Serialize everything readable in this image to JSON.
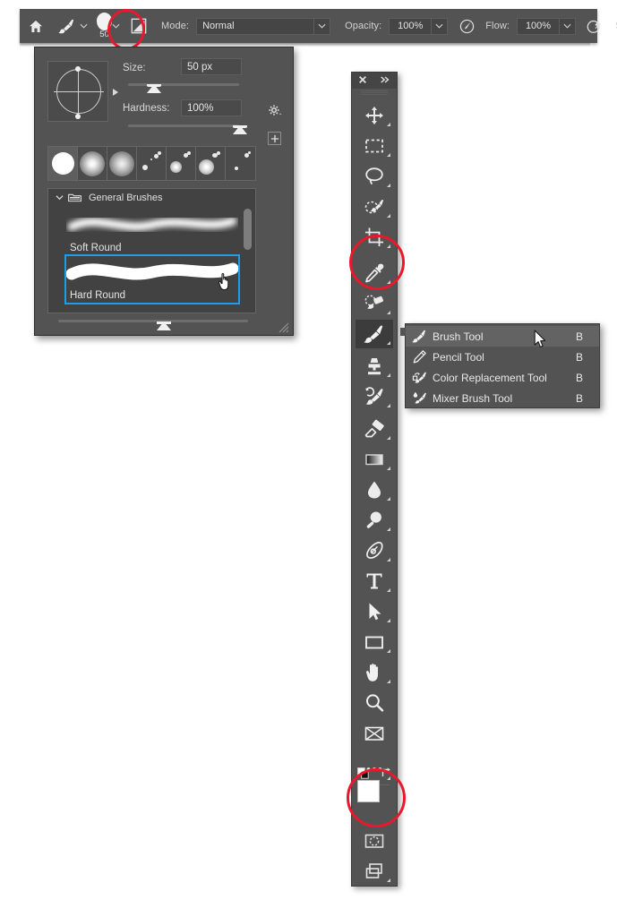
{
  "options_bar": {
    "home_icon": "home-icon",
    "brush_tool_icon": "brush-icon",
    "brush_size_value": "50",
    "preset_picker_icon": "brush-preset-icon",
    "mode_label": "Mode:",
    "mode_value": "Normal",
    "opacity_label": "Opacity:",
    "opacity_value": "100%",
    "opacity_pressure_icon": "pressure-opacity-icon",
    "flow_label": "Flow:",
    "flow_value": "100%",
    "airbrush_icon": "airbrush-icon",
    "smoothing_label": "S"
  },
  "brush_panel": {
    "angle_control_name": "brush-angle-roundness",
    "size_label": "Size:",
    "size_value": "50 px",
    "hardness_label": "Hardness:",
    "hardness_value": "100%",
    "gear_icon": "gear-icon",
    "new_preset_icon": "new-preset-icon",
    "tips": [
      {
        "name": "hard-round-tip",
        "kind": "hard",
        "selected": true
      },
      {
        "name": "soft-round-tip",
        "kind": "soft",
        "selected": false
      },
      {
        "name": "soft-round-pressure-tip",
        "kind": "soft2",
        "selected": false
      },
      {
        "name": "spatter-tip-1",
        "kind": "spatter",
        "selected": false
      },
      {
        "name": "spatter-tip-2",
        "kind": "spatter2",
        "selected": false
      },
      {
        "name": "spatter-tip-3",
        "kind": "spatter3",
        "selected": false
      },
      {
        "name": "spatter-tip-4",
        "kind": "spatter4",
        "selected": false
      }
    ],
    "group_name": "General Brushes",
    "group_expanded": true,
    "brushes": [
      {
        "name": "Soft Round",
        "selected": false,
        "kind": "soft"
      },
      {
        "name": "Hard Round",
        "selected": true,
        "kind": "hard"
      }
    ],
    "scroll_thumb": "list-scrollbar"
  },
  "toolbar": {
    "collapse_icon": "close-icon",
    "expand_icon": "double-chevron-right-icon",
    "tools": [
      {
        "name": "move-tool",
        "icon": "move-icon",
        "has_submenu": true,
        "active": false
      },
      {
        "name": "rectangular-marquee-tool",
        "icon": "marquee-icon",
        "has_submenu": true,
        "active": false
      },
      {
        "name": "lasso-tool",
        "icon": "lasso-icon",
        "has_submenu": true,
        "active": false
      },
      {
        "name": "object-selection-tool",
        "icon": "object-selection-icon",
        "has_submenu": true,
        "active": false
      },
      {
        "name": "crop-tool",
        "icon": "crop-icon",
        "has_submenu": true,
        "active": false
      },
      {
        "name": "eyedropper-tool",
        "icon": "eyedropper-icon",
        "has_submenu": true,
        "active": false
      },
      {
        "name": "spot-healing-brush-tool",
        "icon": "healing-brush-icon",
        "has_submenu": true,
        "active": false
      },
      {
        "name": "brush-tool",
        "icon": "brush-icon",
        "has_submenu": true,
        "active": true
      },
      {
        "name": "clone-stamp-tool",
        "icon": "clone-stamp-icon",
        "has_submenu": true,
        "active": false
      },
      {
        "name": "history-brush-tool",
        "icon": "history-brush-icon",
        "has_submenu": true,
        "active": false
      },
      {
        "name": "eraser-tool",
        "icon": "eraser-icon",
        "has_submenu": true,
        "active": false
      },
      {
        "name": "gradient-tool",
        "icon": "gradient-icon",
        "has_submenu": true,
        "active": false
      },
      {
        "name": "blur-tool",
        "icon": "blur-drop-icon",
        "has_submenu": true,
        "active": false
      },
      {
        "name": "dodge-tool",
        "icon": "dodge-icon",
        "has_submenu": true,
        "active": false
      },
      {
        "name": "pen-tool",
        "icon": "pen-icon",
        "has_submenu": true,
        "active": false
      },
      {
        "name": "type-tool",
        "icon": "type-t-icon",
        "has_submenu": true,
        "active": false
      },
      {
        "name": "path-selection-tool",
        "icon": "path-arrow-icon",
        "has_submenu": true,
        "active": false
      },
      {
        "name": "rectangle-tool",
        "icon": "rectangle-icon",
        "has_submenu": true,
        "active": false
      },
      {
        "name": "hand-tool",
        "icon": "hand-icon",
        "has_submenu": true,
        "active": false
      },
      {
        "name": "zoom-tool",
        "icon": "magnifier-icon",
        "has_submenu": false,
        "active": false
      },
      {
        "name": "frame-tool",
        "icon": "frame-icon",
        "has_submenu": false,
        "active": false
      },
      {
        "name": "edit-toolbar-button",
        "icon": "ellipsis-icon",
        "has_submenu": true,
        "active": false
      }
    ],
    "foreground_color": "#ffffff",
    "background_color": "#000000",
    "default-colors-icon": "default-colors-icon",
    "swap-colors-icon": "swap-colors-icon",
    "quick_mask_icon": "quick-mask-icon",
    "screen_mode_icon": "screen-mode-icon"
  },
  "flyout_menu": {
    "items": [
      {
        "label": "Brush Tool",
        "shortcut": "B",
        "icon": "brush-icon",
        "hover": true
      },
      {
        "label": "Pencil Tool",
        "shortcut": "B",
        "icon": "pencil-icon",
        "hover": false
      },
      {
        "label": "Color Replacement Tool",
        "shortcut": "B",
        "icon": "color-replacement-icon",
        "hover": false
      },
      {
        "label": "Mixer Brush Tool",
        "shortcut": "B",
        "icon": "mixer-brush-icon",
        "hover": false
      }
    ]
  },
  "annotations": {
    "highlight_brush_size": "red-circle-brush-size",
    "highlight_brush_tool": "red-circle-brush-tool",
    "highlight_color_swatches": "red-circle-color-swatches"
  },
  "colors": {
    "panel_bg": "#535353",
    "panel_dark": "#424242",
    "selection_blue": "#1f9ce8",
    "annotation_red": "#e8192c",
    "text": "#e2e2e2"
  }
}
